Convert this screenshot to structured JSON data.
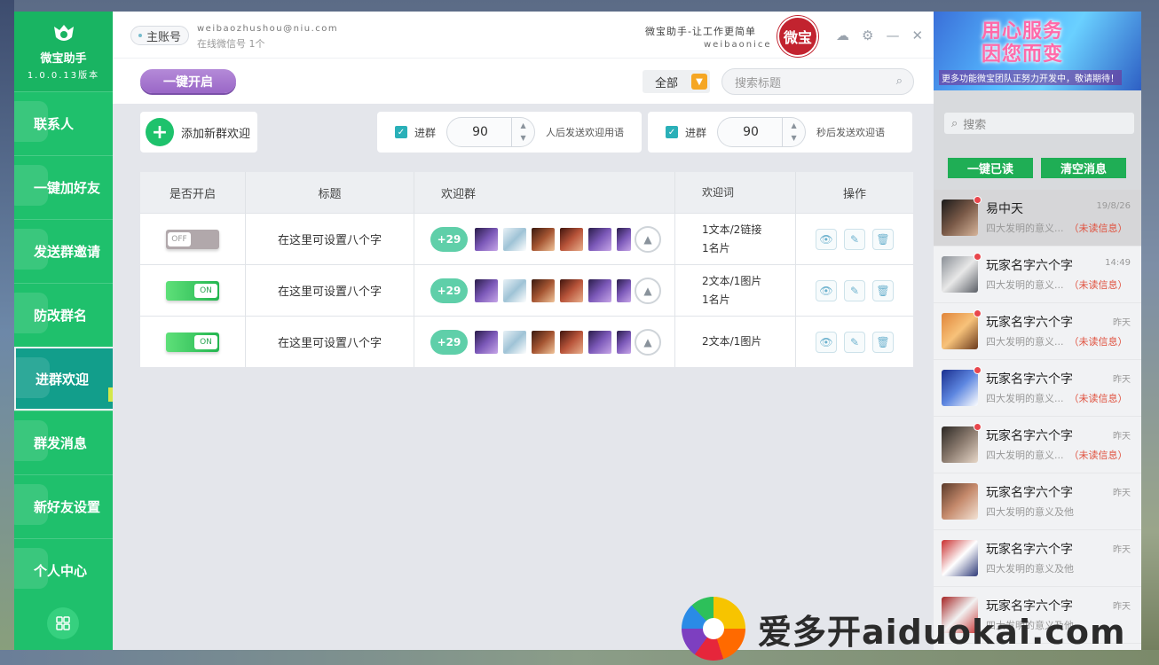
{
  "app": {
    "name": "微宝助手",
    "version": "1.0.0.13版本"
  },
  "sidebar": {
    "items": [
      {
        "label": "联系人"
      },
      {
        "label": "一键加好友"
      },
      {
        "label": "发送群邀请"
      },
      {
        "label": "防改群名"
      },
      {
        "label": "进群欢迎",
        "active": true
      },
      {
        "label": "群发消息"
      },
      {
        "label": "新好友设置"
      },
      {
        "label": "个人中心"
      }
    ],
    "bottom_icon": "grid-icon"
  },
  "header": {
    "account_tag": "主账号",
    "email": "weibaozhushou@niu.com",
    "online": "在线微信号 1个",
    "slogan": "微宝助手-让工作更简单",
    "slogan_en": "weibaonice",
    "seal_text": "微宝"
  },
  "toolbar": {
    "open_all_label": "一键开启",
    "filter_value": "全部",
    "search_placeholder": "搜索标题"
  },
  "add_welcome": {
    "label": "添加新群欢迎"
  },
  "settings": [
    {
      "check_label": "进群",
      "value": "90",
      "suffix": "人后发送欢迎用语",
      "checked": true
    },
    {
      "check_label": "进群",
      "value": "90",
      "suffix": "秒后发送欢迎语",
      "checked": true
    }
  ],
  "table": {
    "headers": [
      "是否开启",
      "标题",
      "欢迎群",
      "欢迎词",
      "操作"
    ],
    "rows": [
      {
        "enabled": false,
        "toggle_text": "OFF",
        "title": "在这里可设置八个字",
        "extra_groups": "+29",
        "words_line1": "1文本/2链接",
        "words_line2": "1名片"
      },
      {
        "enabled": true,
        "toggle_text": "ON",
        "title": "在这里可设置八个字",
        "extra_groups": "+29",
        "words_line1": "2文本/1图片",
        "words_line2": "1名片"
      },
      {
        "enabled": true,
        "toggle_text": "ON",
        "title": "在这里可设置八个字",
        "extra_groups": "+29",
        "words_line1": "2文本/1图片",
        "words_line2": ""
      }
    ]
  },
  "right_panel": {
    "banner_line1": "用心服务",
    "banner_line2": "因您而变",
    "banner_sub": "更多功能微宝团队正努力开发中，敬请期待！",
    "search_placeholder": "搜索",
    "mark_read_label": "一键已读",
    "clear_label": "清空消息",
    "messages": [
      {
        "name": "易中天",
        "time": "19/8/26",
        "preview": "四大发明的意义...",
        "unread": "（未读信息）",
        "dot": true
      },
      {
        "name": "玩家名字六个字",
        "time": "14:49",
        "preview": "四大发明的意义...",
        "unread": "（未读信息）",
        "dot": true
      },
      {
        "name": "玩家名字六个字",
        "time": "昨天",
        "preview": "四大发明的意义...",
        "unread": "（未读信息）",
        "dot": true
      },
      {
        "name": "玩家名字六个字",
        "time": "昨天",
        "preview": "四大发明的意义...",
        "unread": "（未读信息）",
        "dot": true
      },
      {
        "name": "玩家名字六个字",
        "time": "昨天",
        "preview": "四大发明的意义...",
        "unread": "（未读信息）",
        "dot": true
      },
      {
        "name": "玩家名字六个字",
        "time": "昨天",
        "preview": "四大发明的意义及他",
        "unread": "",
        "dot": false
      },
      {
        "name": "玩家名字六个字",
        "time": "昨天",
        "preview": "四大发明的意义及他",
        "unread": "",
        "dot": false
      },
      {
        "name": "玩家名字六个字",
        "time": "昨天",
        "preview": "四大发明的意义及他",
        "unread": "",
        "dot": false
      }
    ]
  },
  "watermark": {
    "text": "爱多开aiduokai.com"
  }
}
